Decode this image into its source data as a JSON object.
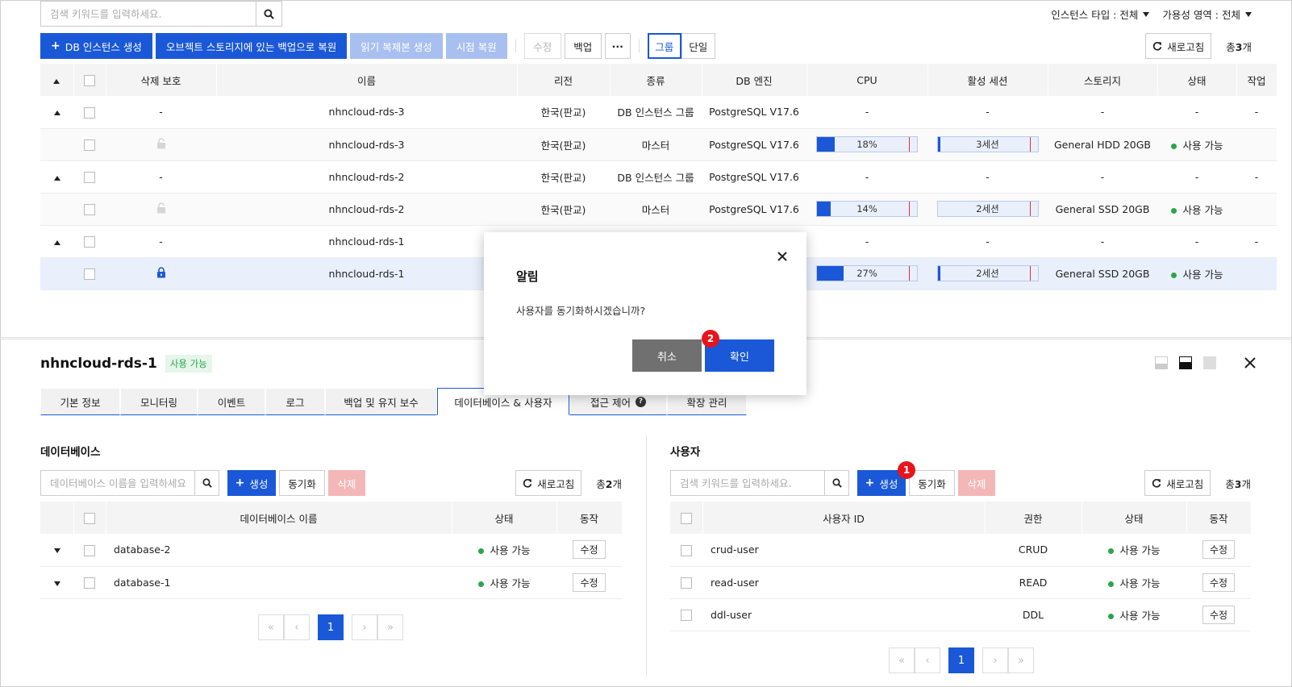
{
  "top": {
    "search_placeholder": "검색 키워드를 입력하세요.",
    "filter_instance_type": "인스턴스 타입 : 전체",
    "filter_availability_zone": "가용성 영역 : 전체"
  },
  "toolbar": {
    "create_db": "DB 인스턴스 생성",
    "restore_backup": "오브젝트 스토리지에 있는 백업으로 복원",
    "create_replica": "읽기 복제본 생성",
    "point_restore": "시점 복원",
    "edit": "수정",
    "backup": "백업",
    "more": "···",
    "group": "그룹",
    "single": "단일",
    "refresh": "새로고침",
    "total_prefix": "총",
    "total_count": "3",
    "total_suffix": "개"
  },
  "main_table": {
    "headers": [
      "삭제 보호",
      "이름",
      "리전",
      "종류",
      "DB 엔진",
      "CPU",
      "활성 세션",
      "스토리지",
      "상태",
      "작업"
    ],
    "rows": [
      {
        "kind": "group",
        "protect": "-",
        "name": "nhncloud-rds-3",
        "region": "한국(판교)",
        "type": "DB 인스턴스 그룹",
        "engine": "PostgreSQL V17.6",
        "cpu": "-",
        "session": "-",
        "storage": "-",
        "status": "-",
        "action": "-"
      },
      {
        "kind": "sub",
        "protect": "lock-open",
        "name": "nhncloud-rds-3",
        "region": "한국(판교)",
        "type": "마스터",
        "engine": "PostgreSQL V17.6",
        "cpu_label": "18%",
        "cpu_value": 18,
        "session_label": "3세션",
        "session_value": 3,
        "storage": "General HDD 20GB",
        "status": "사용 가능"
      },
      {
        "kind": "group",
        "protect": "-",
        "name": "nhncloud-rds-2",
        "region": "한국(판교)",
        "type": "DB 인스턴스 그룹",
        "engine": "PostgreSQL V17.6",
        "cpu": "-",
        "session": "-",
        "storage": "-",
        "status": "-",
        "action": "-"
      },
      {
        "kind": "sub",
        "protect": "lock-open",
        "name": "nhncloud-rds-2",
        "region": "한국(판교)",
        "type": "마스터",
        "engine": "PostgreSQL V17.6",
        "cpu_label": "14%",
        "cpu_value": 14,
        "session_label": "2세션",
        "session_value": 2,
        "storage": "General SSD 20GB",
        "status": "사용 가능"
      },
      {
        "kind": "group",
        "protect": "-",
        "name": "nhncloud-rds-1",
        "cpu": "-",
        "session": "-",
        "storage": "-",
        "status": "-",
        "action": "-"
      },
      {
        "kind": "sub-selected",
        "protect": "lock-closed",
        "name": "nhncloud-rds-1",
        "cpu_label": "27%",
        "cpu_value": 27,
        "session_label": "2세션",
        "session_value": 2,
        "storage": "General SSD 20GB",
        "status": "사용 가능"
      }
    ]
  },
  "detail": {
    "name": "nhncloud-rds-1",
    "status_badge": "사용 가능",
    "tabs": [
      "기본 정보",
      "모니터링",
      "이벤트",
      "로그",
      "백업 및 유지 보수",
      "데이터베이스 & 사용자",
      "접근 제어",
      "확장 관리"
    ],
    "tab_help": "?"
  },
  "databases": {
    "title": "데이터베이스",
    "search_placeholder": "데이터베이스 이름을 입력하세요",
    "create": "생성",
    "sync": "동기화",
    "delete": "삭제",
    "refresh": "새로고침",
    "total_prefix": "총",
    "total_count": "2",
    "total_suffix": "개",
    "headers": [
      "데이터베이스 이름",
      "상태",
      "동작"
    ],
    "rows": [
      {
        "name": "database-2",
        "status": "사용 가능",
        "action": "수정"
      },
      {
        "name": "database-1",
        "status": "사용 가능",
        "action": "수정"
      }
    ],
    "page": "1"
  },
  "users": {
    "title": "사용자",
    "search_placeholder": "검색 키워드를 입력하세요.",
    "create": "생성",
    "sync": "동기화",
    "delete": "삭제",
    "refresh": "새로고침",
    "total_prefix": "총",
    "total_count": "3",
    "total_suffix": "개",
    "headers": [
      "사용자 ID",
      "권한",
      "상태",
      "동작"
    ],
    "rows": [
      {
        "id": "crud-user",
        "perm": "CRUD",
        "status": "사용 가능",
        "action": "수정"
      },
      {
        "id": "read-user",
        "perm": "READ",
        "status": "사용 가능",
        "action": "수정"
      },
      {
        "id": "ddl-user",
        "perm": "DDL",
        "status": "사용 가능",
        "action": "수정"
      }
    ],
    "page": "1"
  },
  "modal": {
    "title": "알림",
    "message": "사용자를 동기화하시겠습니까?",
    "cancel": "취소",
    "confirm": "확인"
  },
  "annotations": {
    "one": "1",
    "two": "2"
  },
  "colors": {
    "primary": "#1a58d7",
    "success": "#2aa54a",
    "marker": "#e8141c"
  }
}
